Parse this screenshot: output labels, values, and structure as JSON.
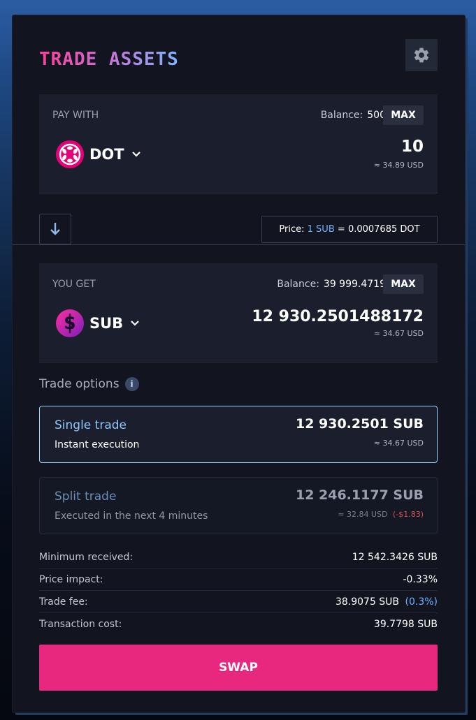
{
  "header": {
    "title": "TRADE ASSETS",
    "settings_icon": "gear-icon"
  },
  "pay": {
    "label": "PAY WITH",
    "balance_label": "Balance:",
    "balance_value": "500",
    "max_label": "MAX",
    "asset": "DOT",
    "amount": "10",
    "usd": "≈ 34.89 USD"
  },
  "switch": {
    "icon": "arrow-down-icon"
  },
  "price": {
    "label": "Price:",
    "base": "1 SUB",
    "eq": "=",
    "value": "0.0007685",
    "quote": "DOT"
  },
  "get": {
    "label": "YOU GET",
    "balance_label": "Balance:",
    "balance_value": "39 999.4719",
    "max_label": "MAX",
    "asset": "SUB",
    "amount": "12 930.2501488172",
    "usd": "≈ 34.67 USD"
  },
  "options": {
    "title": "Trade options",
    "info_icon": "info-icon",
    "single": {
      "title": "Single trade",
      "subtitle": "Instant execution",
      "amount": "12 930.2501 SUB",
      "usd": "≈ 34.67 USD"
    },
    "split": {
      "title": "Split trade",
      "subtitle": "Executed in the next 4 minutes",
      "amount": "12 246.1177 SUB",
      "usd": "≈ 32.84 USD",
      "diff": "(-$1.83)"
    }
  },
  "details": {
    "min_received_label": "Minimum received:",
    "min_received_value": "12 542.3426 SUB",
    "impact_label": "Price impact:",
    "impact_value": "-0.33%",
    "fee_label": "Trade fee:",
    "fee_value": "38.9075 SUB",
    "fee_pct": "(0.3%)",
    "cost_label": "Transaction cost:",
    "cost_value": "39.7798 SUB"
  },
  "swap_label": "SWAP",
  "colors": {
    "accent": "#e8287f",
    "link": "#6fb2ff",
    "selected_border": "#9fd3f8",
    "negative": "#e0564f"
  }
}
